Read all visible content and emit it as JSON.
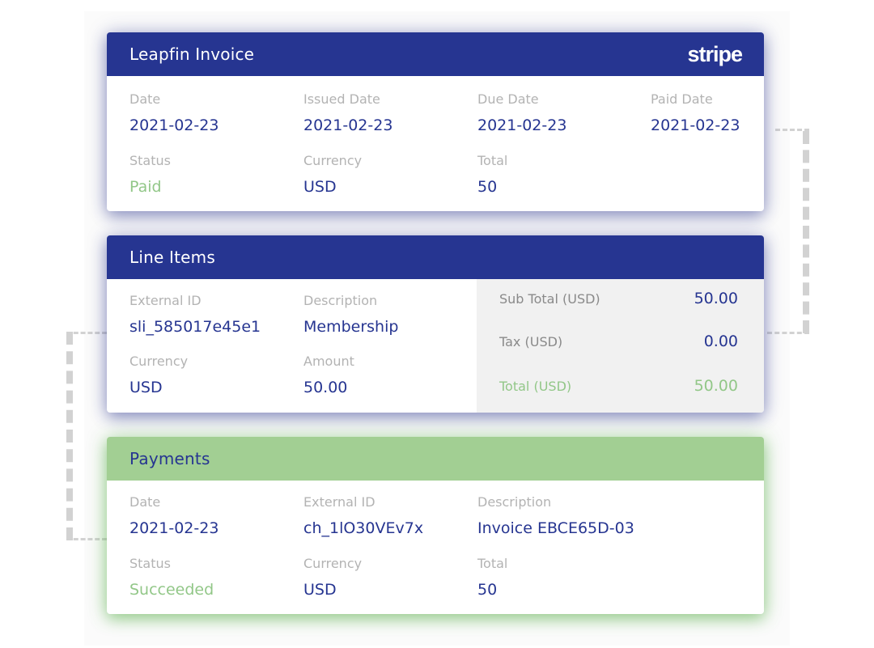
{
  "invoice": {
    "title": "Leapfin Invoice",
    "logo_text": "stripe",
    "fields": [
      {
        "label": "Date",
        "value": "2021-02-23"
      },
      {
        "label": "Issued Date",
        "value": "2021-02-23"
      },
      {
        "label": "Due Date",
        "value": "2021-02-23"
      },
      {
        "label": "Paid Date",
        "value": "2021-02-23"
      },
      {
        "label": "Status",
        "value": "Paid"
      },
      {
        "label": "Currency",
        "value": "USD"
      },
      {
        "label": "Total",
        "value": "50"
      }
    ]
  },
  "line_items": {
    "title": "Line Items",
    "fields": [
      {
        "label": "External ID",
        "value": "sli_585017e45e1"
      },
      {
        "label": "Description",
        "value": "Membership"
      },
      {
        "label": "Currency",
        "value": "USD"
      },
      {
        "label": "Amount",
        "value": "50.00"
      }
    ],
    "summary": [
      {
        "label": "Sub Total (USD)",
        "value": "50.00"
      },
      {
        "label": "Tax (USD)",
        "value": "0.00"
      },
      {
        "label": "Total (USD)",
        "value": "50.00"
      }
    ]
  },
  "payments": {
    "title": "Payments",
    "fields": [
      {
        "label": "Date",
        "value": "2021-02-23"
      },
      {
        "label": "External ID",
        "value": "ch_1lO30VEv7x"
      },
      {
        "label": "Description",
        "value": "Invoice EBCE65D-03"
      },
      {
        "label": "Status",
        "value": "Succeeded"
      },
      {
        "label": "Currency",
        "value": "USD"
      },
      {
        "label": "Total",
        "value": "50"
      }
    ]
  },
  "colors": {
    "header_blue": "#263591",
    "header_green": "#a2cf93",
    "value_blue": "#263591",
    "status_green": "#92c788",
    "label_gray": "#b3b3b3",
    "summary_bg": "#f1f1f1"
  }
}
